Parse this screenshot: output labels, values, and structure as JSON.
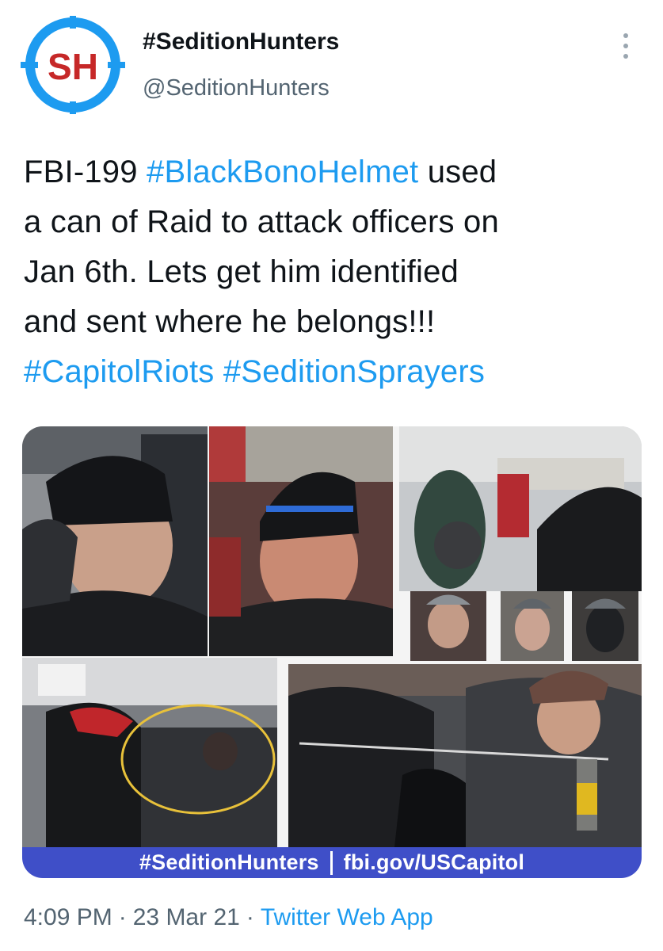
{
  "author": {
    "avatar_text": "SH",
    "display_name": "#SeditionHunters",
    "handle": "@SeditionHunters"
  },
  "tweet": {
    "lines": [
      {
        "text_before": "FBI-199 ",
        "hashtag": "#BlackBonoHelmet",
        "text_after": " used"
      },
      {
        "text": "a can of Raid to attack officers on"
      },
      {
        "text": "Jan 6th. Lets get him identified"
      },
      {
        "text": "and sent where he belongs!!!"
      },
      {
        "hashtag_1": "#CapitolRiots",
        "hashtag_2": "#SeditionSprayers"
      }
    ]
  },
  "media": {
    "banner_left": "#SeditionHunters",
    "banner_right": "fbi.gov/USCapitol"
  },
  "meta": {
    "time": "4:09 PM",
    "date": "23 Mar 21",
    "source": "Twitter Web App"
  },
  "colors": {
    "link": "#1d9bf0",
    "avatar_ring": "#1d9bf0",
    "avatar_text": "#c62828",
    "banner": "#3f4fc8"
  }
}
